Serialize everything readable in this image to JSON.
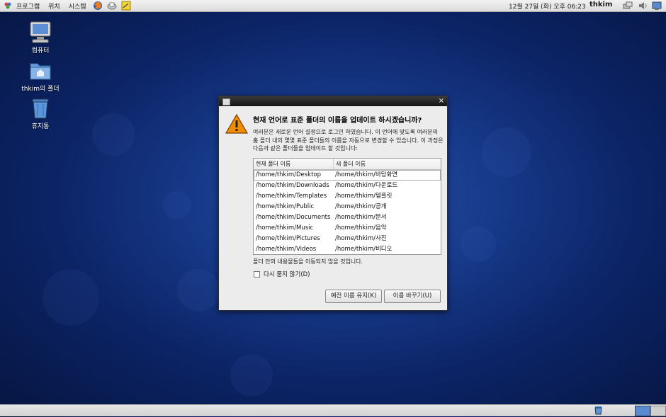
{
  "top_panel": {
    "menus": [
      "프로그램",
      "위치",
      "시스템"
    ],
    "launchers": [
      "firefox-icon",
      "mail-icon",
      "notes-icon"
    ],
    "clock": "12월 27일 (화) 오후 06:23",
    "user": "thkim",
    "tray": [
      "network-icon",
      "volume-icon",
      "update-icon"
    ]
  },
  "desktop": {
    "icons": [
      {
        "label": "컴퓨터",
        "icon": "computer-icon"
      },
      {
        "label": "thkim의 폴더",
        "icon": "home-folder-icon"
      },
      {
        "label": "휴지통",
        "icon": "trash-icon"
      }
    ]
  },
  "dialog": {
    "close": "×",
    "title": "현재 언어로 표준 폴더의 이름을 업데이트 하시겠습니까?",
    "description": "여러분은 새로운 언어 설정으로 로그인 하였습니다. 이 언어에 맞도록 여러분의 홈 폴더 내의 몇몇 표준 폴더들의 이름을 자동으로 변경할 수 있습니다. 이 과정은 다음과 같은 폴더들을 업데이트 할 것입니다:",
    "columns": [
      "현재 폴더 이름",
      "새 폴더 이름"
    ],
    "rows": [
      [
        "/home/thkim/Desktop",
        "/home/thkim/바탕화면"
      ],
      [
        "/home/thkim/Downloads",
        "/home/thkim/다운로드"
      ],
      [
        "/home/thkim/Templates",
        "/home/thkim/템플릿"
      ],
      [
        "/home/thkim/Public",
        "/home/thkim/공개"
      ],
      [
        "/home/thkim/Documents",
        "/home/thkim/문서"
      ],
      [
        "/home/thkim/Music",
        "/home/thkim/음악"
      ],
      [
        "/home/thkim/Pictures",
        "/home/thkim/사진"
      ],
      [
        "/home/thkim/Videos",
        "/home/thkim/비디오"
      ]
    ],
    "note": "폴더 안의 내용물들을 이동되지 않을 것입니다.",
    "checkbox_label": "다시 묻지 않기(D)",
    "checkbox_checked": false,
    "keep_button": "예전 이름 유지(K)",
    "rename_button": "이름 바꾸기(U)"
  }
}
